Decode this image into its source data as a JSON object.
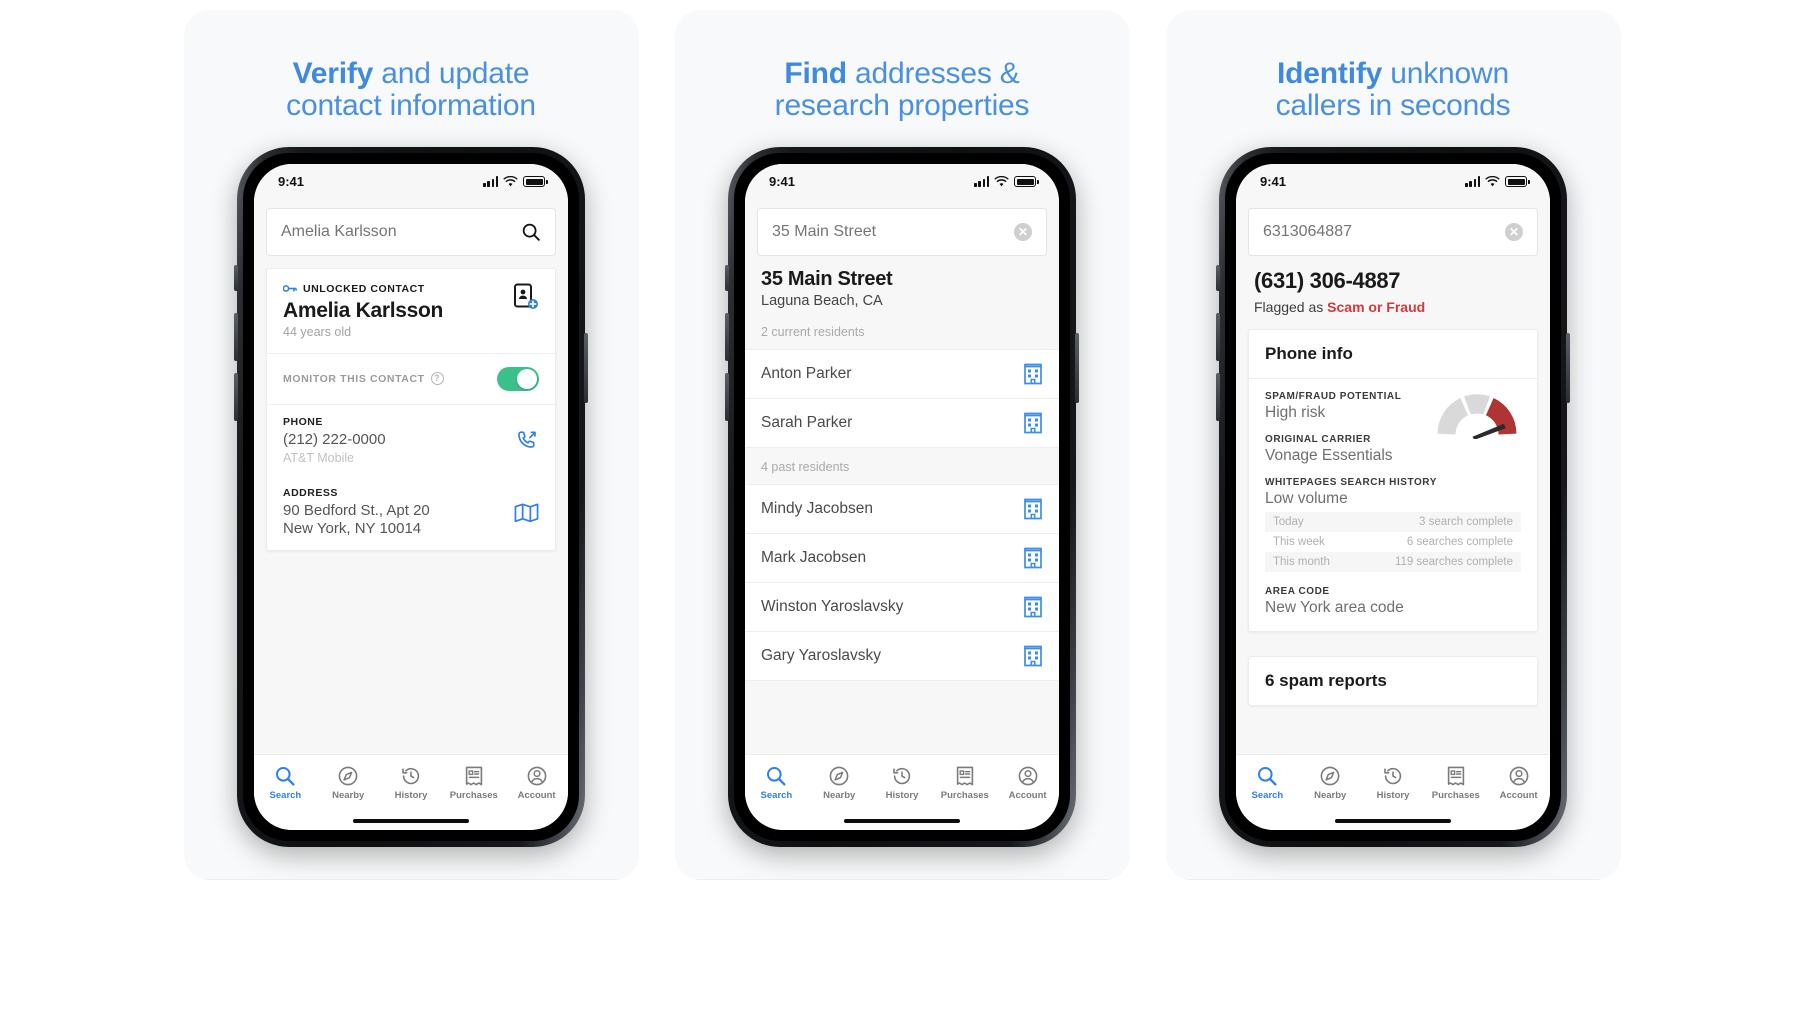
{
  "panels": [
    {
      "headline_bold": "Verify",
      "headline_rest": " and update",
      "headline_line2": "contact information",
      "status": {
        "time": "9:41"
      },
      "search": {
        "value": "Amelia Karlsson",
        "placeholder": "Amelia Karlsson",
        "icon": "search-icon"
      },
      "contact": {
        "tagline": "UNLOCKED CONTACT",
        "name": "Amelia Karlsson",
        "age": "44 years old",
        "monitor_label": "MONITOR THIS CONTACT",
        "monitor_on": true,
        "phone_label": "PHONE",
        "phone_value": "(212) 222-0000",
        "phone_carrier": "AT&T Mobile",
        "address_label": "ADDRESS",
        "address_line1": "90 Bedford St., Apt 20",
        "address_line2": "New York, NY 10014"
      }
    },
    {
      "headline_bold": "Find",
      "headline_rest": " addresses &",
      "headline_line2": "research properties",
      "status": {
        "time": "9:41"
      },
      "search": {
        "value": "35 Main Street",
        "placeholder": "35 Main Street",
        "icon": "clear-icon"
      },
      "address": {
        "title": "35 Main Street",
        "city": "Laguna Beach, CA",
        "current_label": "2 current residents",
        "current": [
          "Anton Parker",
          "Sarah Parker"
        ],
        "past_label": "4 past residents",
        "past": [
          "Mindy Jacobsen",
          "Mark Jacobsen",
          "Winston Yaroslavsky",
          "Gary Yaroslavsky"
        ]
      }
    },
    {
      "headline_bold": "Identify",
      "headline_rest": " unknown",
      "headline_line2": "callers in seconds",
      "status": {
        "time": "9:41"
      },
      "search": {
        "value": "6313064887",
        "placeholder": "6313064887",
        "icon": "clear-icon"
      },
      "caller": {
        "number": "(631) 306-4887",
        "flag_prefix": "Flagged as ",
        "flag_value": "Scam or Fraud",
        "card_title": "Phone info",
        "spam_label": "SPAM/FRAUD POTENTIAL",
        "spam_value": "High risk",
        "carrier_label": "ORIGINAL CARRIER",
        "carrier_value": "Vonage Essentials",
        "history_label": "WHITEPAGES SEARCH HISTORY",
        "history_value": "Low volume",
        "history_rows": [
          {
            "period": "Today",
            "count": "3 search complete"
          },
          {
            "period": "This week",
            "count": "6 searches complete"
          },
          {
            "period": "This month",
            "count": "119 searches complete"
          }
        ],
        "areacode_label": "AREA CODE",
        "areacode_value": "New York area code",
        "spam_reports": "6 spam reports"
      }
    }
  ],
  "tabbar": {
    "items": [
      {
        "label": "Search",
        "icon": "search-icon",
        "active": true
      },
      {
        "label": "Nearby",
        "icon": "compass-icon",
        "active": false
      },
      {
        "label": "History",
        "icon": "history-icon",
        "active": false
      },
      {
        "label": "Purchases",
        "icon": "receipt-icon",
        "active": false
      },
      {
        "label": "Account",
        "icon": "account-icon",
        "active": false
      }
    ]
  },
  "colors": {
    "accent_blue": "#4a90e2",
    "tab_active": "#2f80ed",
    "toggle_green": "#3cc08a",
    "danger_red": "#d03a3a",
    "gauge_red": "#b03434",
    "gauge_grey": "#d9d9d9"
  }
}
